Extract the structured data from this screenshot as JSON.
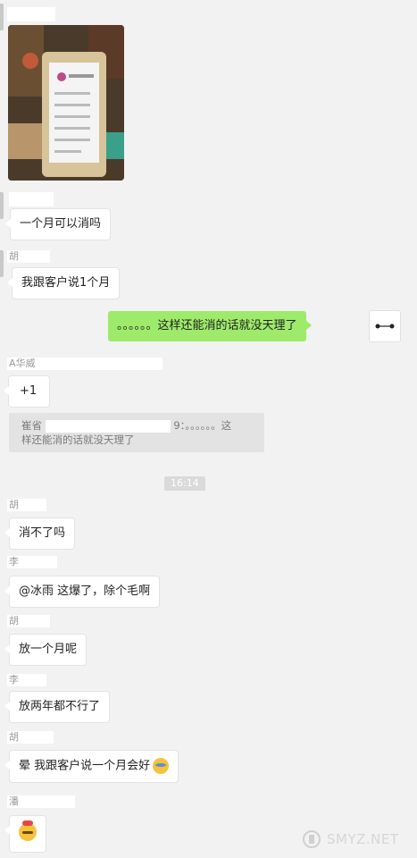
{
  "chat": {
    "messages": [
      {
        "text": "一个月可以消吗"
      },
      {
        "text": "我跟客户说1个月"
      },
      {
        "text": "。。。。。。这样还能消的话就没天理了"
      },
      {
        "text": "+1"
      },
      {
        "text": "消不了吗"
      },
      {
        "text": "@冰雨 这爆了，除个毛啊"
      },
      {
        "text": "放一个月呢"
      },
      {
        "text": "放两年都不行了"
      },
      {
        "text": "晕  我跟客户说一个月会好"
      }
    ],
    "quote": {
      "line1_prefix": "崔省",
      "line1_suffix": "9：。。。。。。这",
      "line2": "样还能消的话就没天理了"
    },
    "sender_names": {
      "s1": "A华威",
      "s2": "胡",
      "s3": "胡",
      "s4": "胡",
      "s5": "李",
      "s6": "李",
      "s7": "胡",
      "s8": "潘"
    },
    "time_separator": "16:14"
  },
  "watermark": {
    "text": "SMYZ.NET"
  },
  "icons": {
    "photo": "phone-photo",
    "avatar": "avatar-icon",
    "emoji_laugh": "laugh-cry-emoji",
    "emoji_sweat": "sweat-emoji",
    "watermark_logo": "watermark-logo-icon"
  },
  "colors": {
    "background": "#f2f2f2",
    "bubble_self": "#9eea6a",
    "bubble_other": "#ffffff",
    "quote_bg": "#e3e3e3",
    "time_bg": "#dadada"
  }
}
